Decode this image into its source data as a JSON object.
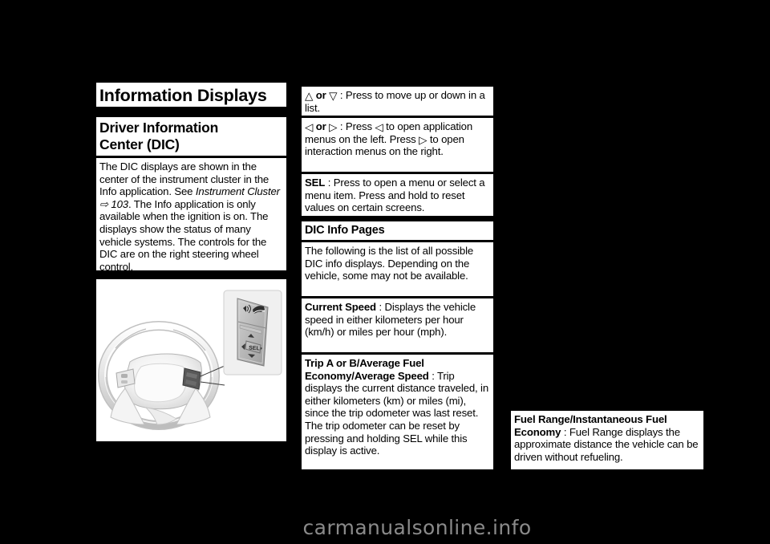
{
  "page": {
    "background_color": "#000000",
    "text_block_color": "#ffffff",
    "watermark": "carmanualsonline.info",
    "watermark_color": "#8a8a8a"
  },
  "column1": {
    "title": "Information Displays",
    "subtitle_line1": "Driver Information",
    "subtitle_line2": "Center (DIC)",
    "body_part1": "The DIC displays are shown in the center of the instrument cluster in the Info application. See ",
    "body_reference": "Instrument Cluster",
    "body_reference_arrow": "⇨",
    "body_reference_page": "103",
    "body_part2": ". The Info application is only available when the ignition is on. The displays show the status of many vehicle systems. The controls for the DIC are on the right steering wheel control.",
    "figure": {
      "name": "steering-wheel-with-dic-controls",
      "callout_button_label": "SEL",
      "icons": [
        "voice-recognition-icon",
        "phone-icon",
        "up-arrow-icon",
        "down-arrow-icon",
        "left-arrow-icon",
        "right-arrow-icon"
      ]
    }
  },
  "column2": {
    "updown": {
      "symbol_up": "△",
      "conjunction": "or",
      "symbol_down": "▽",
      "colon": ":",
      "text": " Press to move up or down in a list."
    },
    "leftright": {
      "symbol_left": "◁",
      "conjunction": "or",
      "symbol_right": "▷",
      "colon": ":",
      "text_part1": " Press ",
      "text_part2": " to open application menus on the left. Press ",
      "text_part3": " to open interaction menus on the right."
    },
    "sel": {
      "label": "SEL",
      "colon": ":",
      "text": " Press to open a menu or select a menu item. Press and hold to reset values on certain screens."
    },
    "pages_heading": "DIC Info Pages",
    "pages_intro": "The following is the list of all possible DIC info displays. Depending on the vehicle, some may not be available.",
    "current_speed": {
      "label": "Current Speed",
      "colon": ":",
      "text": " Displays the vehicle speed in either kilometers per hour (km/h) or miles per hour (mph)."
    },
    "trip": {
      "label_line1": "Trip A or B/Average Fuel",
      "label_line2": "Economy/Average Speed",
      "colon": ":",
      "text": " Trip displays the current distance traveled, in either kilometers (km) or miles (mi), since the trip odometer was last reset. The trip odometer can be reset by pressing and holding SEL while this display is active."
    }
  },
  "column3": {
    "fuel_range": {
      "label_line1": "Fuel Range/Instantaneous Fuel",
      "label_line2": "Economy",
      "colon": ":",
      "text": " Fuel Range displays the approximate distance the vehicle can be driven without refueling."
    }
  }
}
